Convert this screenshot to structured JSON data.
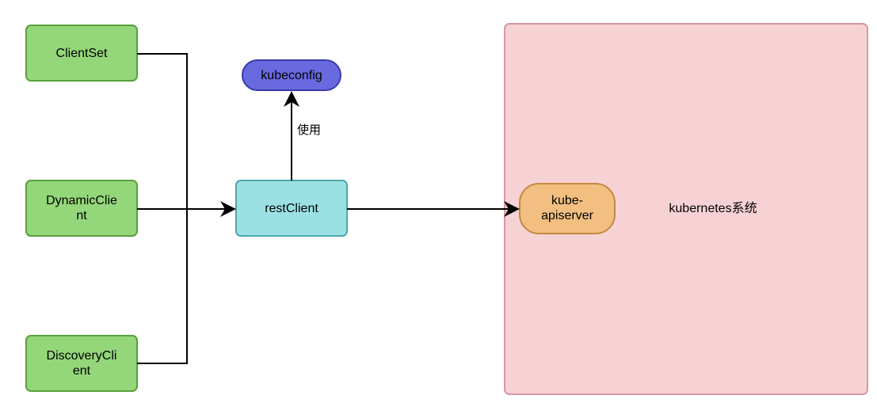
{
  "diagram": {
    "clients": {
      "client_set": "ClientSet",
      "dynamic_client_l1": "DynamicClie",
      "dynamic_client_l2": "nt",
      "discovery_client_l1": "DiscoveryCli",
      "discovery_client_l2": "ent"
    },
    "rest_client": "restClient",
    "kubeconfig": "kubeconfig",
    "uses_label": "使用",
    "apiserver_l1": "kube-",
    "apiserver_l2": "apiserver",
    "system_label": "kubernetes系统"
  },
  "colors": {
    "green_fill": "#94d67a",
    "green_stroke": "#5aa03e",
    "cyan_fill": "#9be1e4",
    "cyan_stroke": "#4aa8ab",
    "blue_fill": "#6969e0",
    "blue_stroke": "#3a3aa8",
    "orange_fill": "#f2bf80",
    "orange_stroke": "#c28a3f",
    "pink_fill": "#f7d2d5",
    "pink_stroke": "#d49a9f",
    "arrow": "#000"
  }
}
